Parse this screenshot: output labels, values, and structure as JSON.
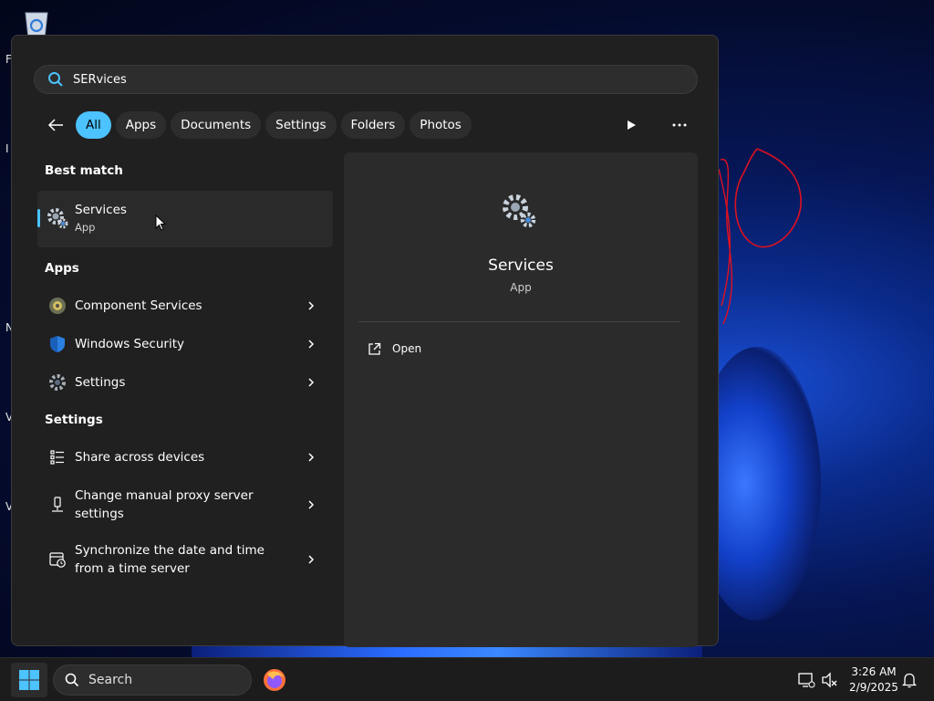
{
  "search": {
    "value": "SERvices"
  },
  "filters": [
    {
      "label": "All",
      "active": true
    },
    {
      "label": "Apps"
    },
    {
      "label": "Documents"
    },
    {
      "label": "Settings"
    },
    {
      "label": "Folders"
    },
    {
      "label": "Photos"
    }
  ],
  "best_match": {
    "title": "Best match",
    "name": "Services",
    "type": "App"
  },
  "apps": {
    "title": "Apps",
    "items": [
      {
        "label": "Component Services",
        "icon": "component-services-icon"
      },
      {
        "label": "Windows Security",
        "icon": "shield-icon"
      },
      {
        "label": "Settings",
        "icon": "gear-icon"
      }
    ]
  },
  "settings": {
    "title": "Settings",
    "items": [
      {
        "label": "Share across devices",
        "icon": "share-devices-icon"
      },
      {
        "label": "Change manual proxy server settings",
        "icon": "proxy-icon"
      },
      {
        "label": "Synchronize the date and time from a time server",
        "icon": "time-sync-icon"
      }
    ]
  },
  "preview": {
    "name": "Services",
    "type": "App",
    "action": "Open"
  },
  "taskbar": {
    "search_label": "Search",
    "time": "3:26 AM",
    "date": "2/9/2025"
  },
  "colors": {
    "accent": "#4cc2ff",
    "panel_bg": "#202020",
    "preview_bg": "#2b2b2b",
    "taskbar_bg": "#1c1c1c"
  }
}
